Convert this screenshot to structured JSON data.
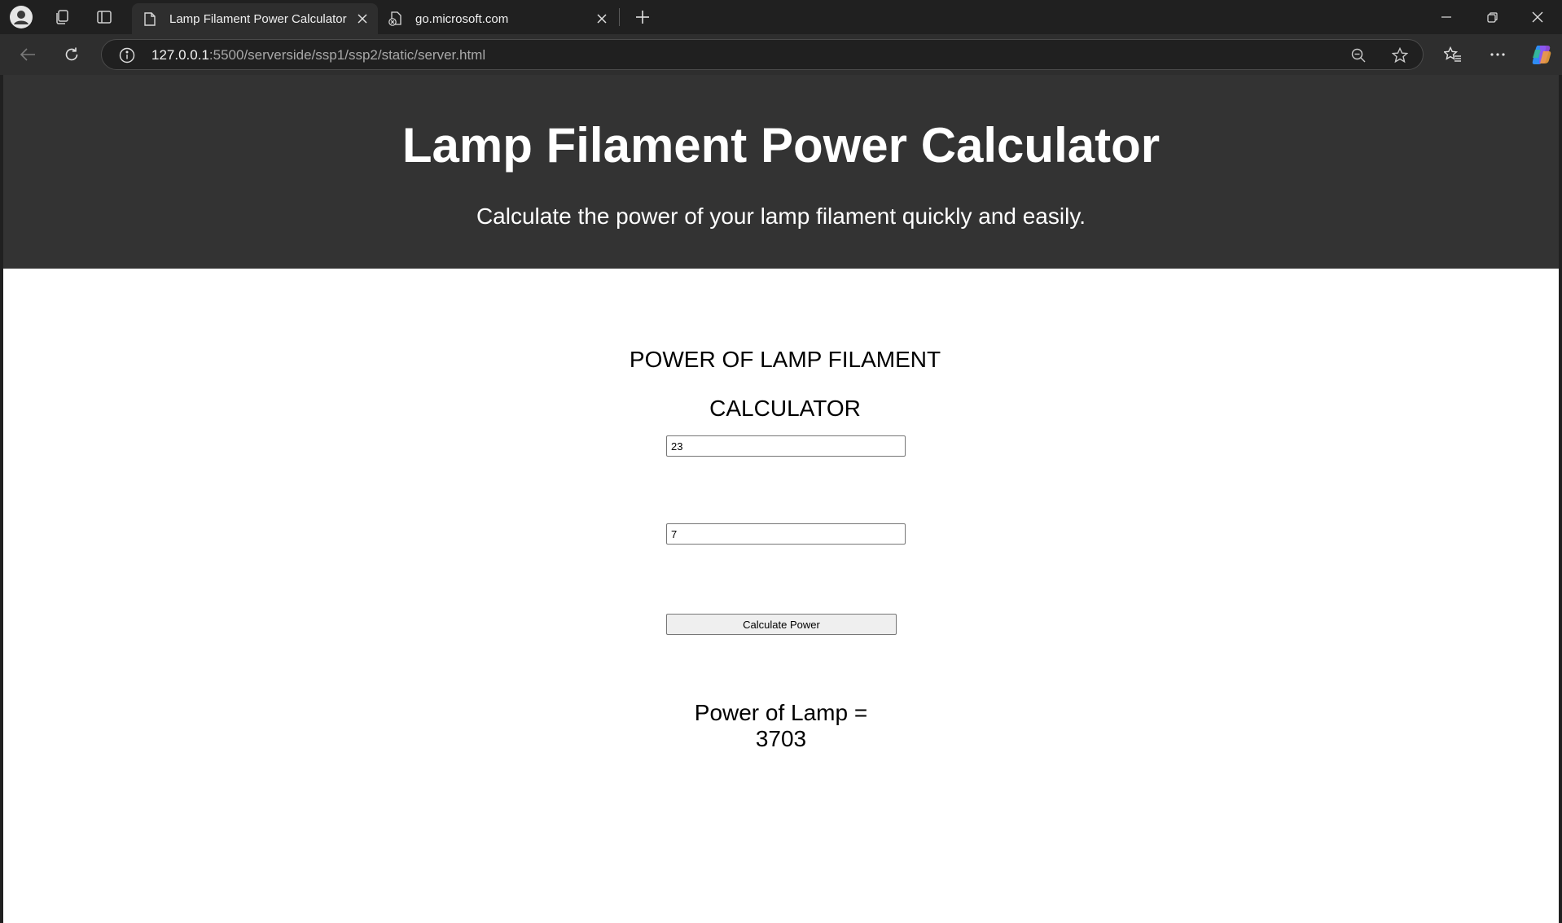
{
  "browser": {
    "tabs": [
      {
        "title": "Lamp Filament Power Calculator",
        "active": true
      },
      {
        "title": "go.microsoft.com",
        "active": false
      }
    ],
    "url_host": "127.0.0.1",
    "url_rest": ":5500/serverside/ssp1/ssp2/static/server.html"
  },
  "page": {
    "header_title": "Lamp Filament Power Calculator",
    "header_subtitle": "Calculate the power of your lamp filament quickly and easily.",
    "form_heading_line1": "POWER OF LAMP FILAMENT",
    "form_heading_line2": "CALCULATOR",
    "input1_value": "23",
    "input2_value": "7",
    "button_label": "Calculate Power",
    "result_label": "Power of Lamp =",
    "result_value": "3703"
  },
  "colors": {
    "browser_chrome": "#202020",
    "toolbar": "#2e2e2e",
    "page_header": "#333333",
    "page_background": "#ffffff"
  }
}
